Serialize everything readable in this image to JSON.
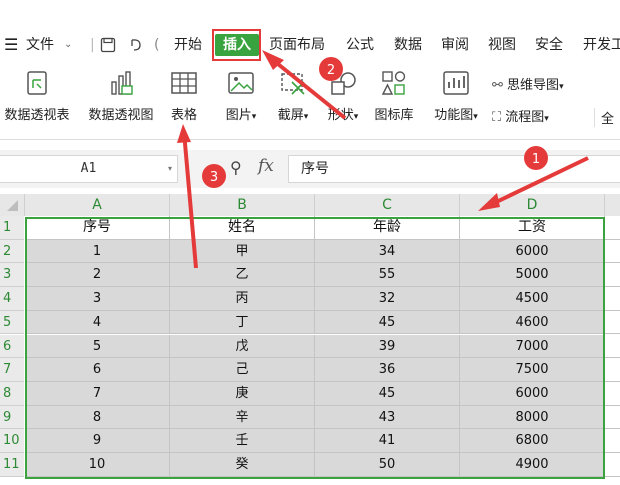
{
  "menu": {
    "hamburger_icon": "hamburger-icon",
    "file_label": "文件",
    "items": [
      "开始",
      "插入",
      "页面布局",
      "公式",
      "数据",
      "审阅",
      "视图",
      "安全",
      "开发工"
    ]
  },
  "ribbon": {
    "buttons": [
      {
        "label": "数据透视表",
        "icon": "pivot-table-icon"
      },
      {
        "label": "数据透视图",
        "icon": "pivot-chart-icon"
      },
      {
        "label": "表格",
        "icon": "table-icon"
      },
      {
        "label": "图片",
        "icon": "picture-icon"
      },
      {
        "label": "截屏",
        "icon": "screenshot-icon"
      },
      {
        "label": "形状",
        "icon": "shape-icon"
      },
      {
        "label": "图标库",
        "icon": "icon-library-icon"
      },
      {
        "label": "功能图",
        "icon": "function-chart-icon"
      }
    ],
    "small_buttons": [
      {
        "label": "思维导图",
        "icon": "mindmap-icon"
      },
      {
        "label": "流程图",
        "icon": "flowchart-icon"
      }
    ],
    "more_label": "全"
  },
  "formula_bar": {
    "cell_ref": "A1",
    "fx_label": "fx",
    "content": "序号"
  },
  "sheet": {
    "columns": [
      "A",
      "B",
      "C",
      "D"
    ],
    "row_numbers": [
      "1",
      "2",
      "3",
      "4",
      "5",
      "6",
      "7",
      "8",
      "9",
      "10",
      "11"
    ],
    "rows": [
      [
        "序号",
        "姓名",
        "年龄",
        "工资"
      ],
      [
        "1",
        "甲",
        "34",
        "6000"
      ],
      [
        "2",
        "乙",
        "55",
        "5000"
      ],
      [
        "3",
        "丙",
        "32",
        "4500"
      ],
      [
        "4",
        "丁",
        "45",
        "4600"
      ],
      [
        "5",
        "戊",
        "39",
        "7000"
      ],
      [
        "6",
        "己",
        "36",
        "7500"
      ],
      [
        "7",
        "庚",
        "45",
        "6000"
      ],
      [
        "8",
        "辛",
        "43",
        "8000"
      ],
      [
        "9",
        "壬",
        "41",
        "6800"
      ],
      [
        "10",
        "癸",
        "50",
        "4900"
      ]
    ]
  },
  "annotations": {
    "markers": [
      "1",
      "2",
      "3"
    ],
    "color": "#e53a3a"
  },
  "colors": {
    "accent_green": "#39a33f",
    "highlight_red": "#e53a3a"
  }
}
